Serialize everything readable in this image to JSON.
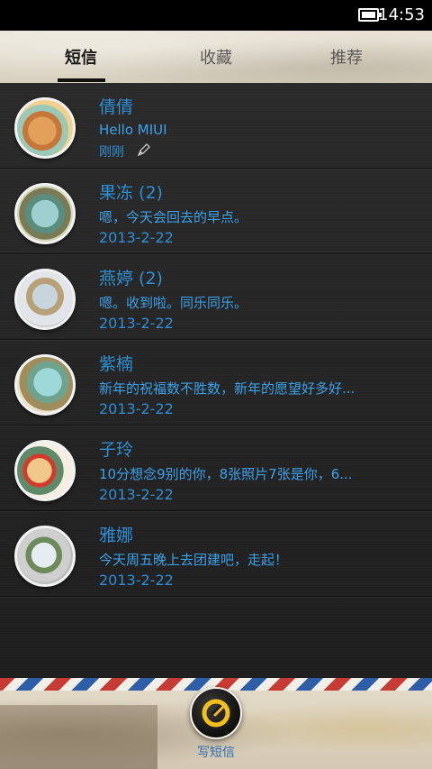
{
  "status_bar": {
    "time": "14:53"
  },
  "tabs": [
    {
      "label": "短信",
      "active": true
    },
    {
      "label": "收藏",
      "active": false
    },
    {
      "label": "推荐",
      "active": false
    }
  ],
  "conversations": [
    {
      "name": "倩倩",
      "preview": "Hello MIUI",
      "date": "刚刚",
      "has_draft_icon": true
    },
    {
      "name": "果冻  (2)",
      "preview": "嗯，今天会回去的早点。",
      "date": "2013-2-22"
    },
    {
      "name": "燕婷  (2)",
      "preview": "嗯。收到啦。同乐同乐。",
      "date": "2013-2-22"
    },
    {
      "name": "紫楠",
      "preview": "新年的祝福数不胜数，新年的愿望好多好...",
      "date": "2013-2-22"
    },
    {
      "name": "子玲",
      "preview": "10分想念9别的你，8张照片7张是你，6...",
      "date": "2013-2-22"
    },
    {
      "name": "雅娜",
      "preview": "今天周五晚上去团建吧，走起！",
      "date": "2013-2-22"
    }
  ],
  "footer": {
    "compose_label": "写短信"
  },
  "colors": {
    "accent": "#2d8fd5",
    "list_background": "#1e1e1e",
    "compose_icon": "#f2c018"
  }
}
